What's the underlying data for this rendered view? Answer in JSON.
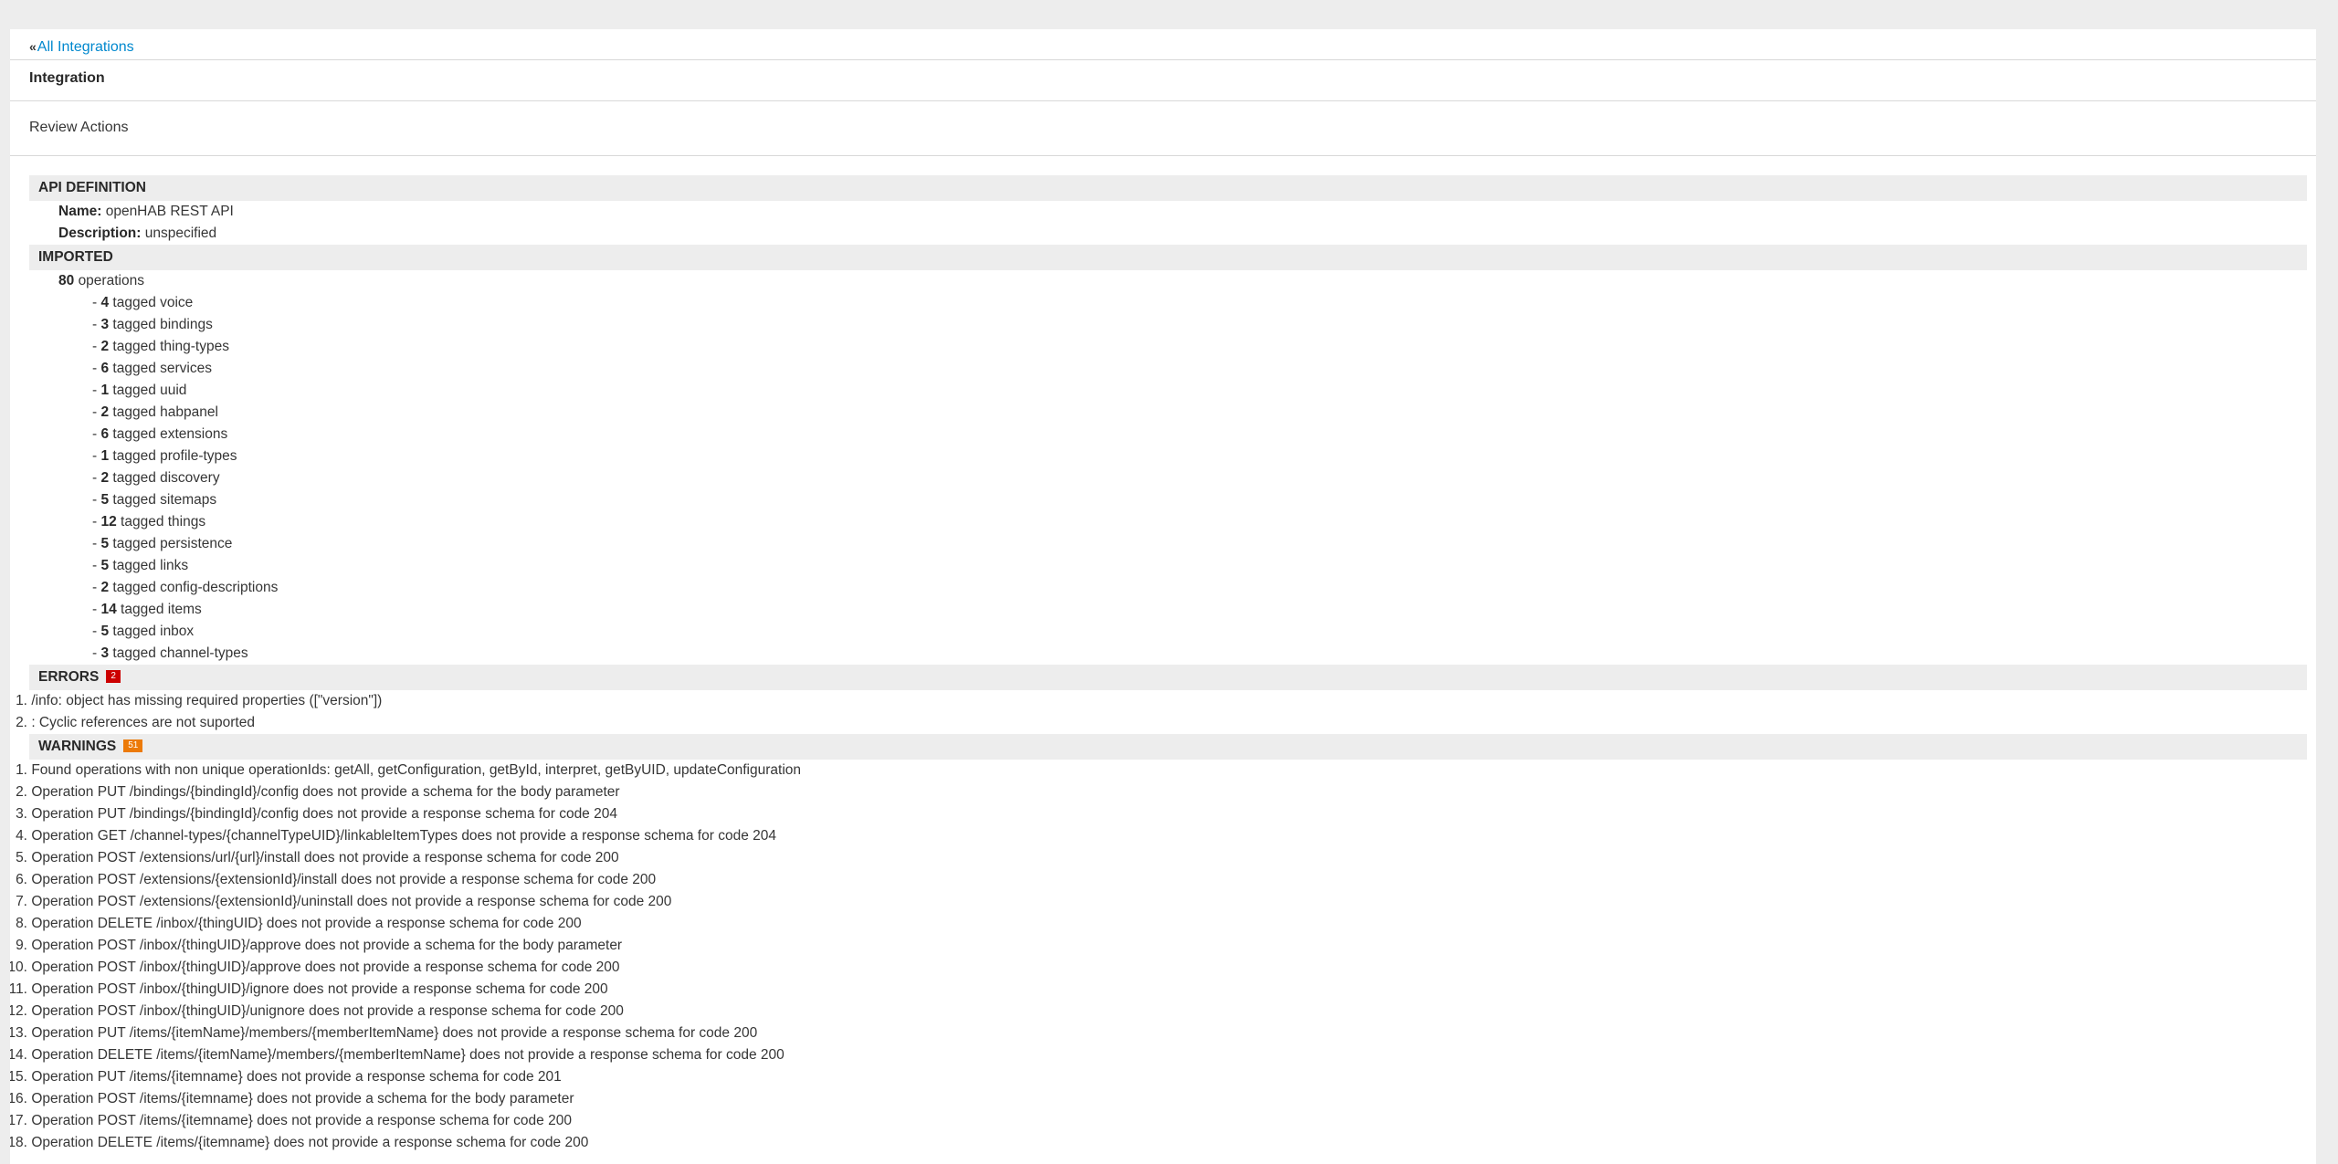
{
  "breadcrumb": {
    "link_label": "All Integrations"
  },
  "page": {
    "title": "Integration",
    "step": "Review Actions"
  },
  "api_definition": {
    "header": "API DEFINITION",
    "name_label": "Name:",
    "name_value": "openHAB REST API",
    "description_label": "Description:",
    "description_value": "unspecified"
  },
  "imported": {
    "header": "IMPORTED",
    "total": "80",
    "total_label": "operations",
    "tags": [
      {
        "count": "4",
        "label": "tagged voice"
      },
      {
        "count": "3",
        "label": "tagged bindings"
      },
      {
        "count": "2",
        "label": "tagged thing-types"
      },
      {
        "count": "6",
        "label": "tagged services"
      },
      {
        "count": "1",
        "label": "tagged uuid"
      },
      {
        "count": "2",
        "label": "tagged habpanel"
      },
      {
        "count": "6",
        "label": "tagged extensions"
      },
      {
        "count": "1",
        "label": "tagged profile-types"
      },
      {
        "count": "2",
        "label": "tagged discovery"
      },
      {
        "count": "5",
        "label": "tagged sitemaps"
      },
      {
        "count": "12",
        "label": "tagged things"
      },
      {
        "count": "5",
        "label": "tagged persistence"
      },
      {
        "count": "5",
        "label": "tagged links"
      },
      {
        "count": "2",
        "label": "tagged config-descriptions"
      },
      {
        "count": "14",
        "label": "tagged items"
      },
      {
        "count": "5",
        "label": "tagged inbox"
      },
      {
        "count": "3",
        "label": "tagged channel-types"
      }
    ]
  },
  "errors": {
    "header": "ERRORS",
    "badge": "2",
    "items": [
      {
        "num": "1.",
        "text": "/info: object has missing required properties ([\"version\"])"
      },
      {
        "num": "2.",
        "text": ": Cyclic references are not suported"
      }
    ]
  },
  "warnings": {
    "header": "WARNINGS",
    "badge": "51",
    "items": [
      {
        "num": "1.",
        "text": "Found operations with non unique operationIds: getAll, getConfiguration, getById, interpret, getByUID, updateConfiguration"
      },
      {
        "num": "2.",
        "text": "Operation PUT /bindings/{bindingId}/config does not provide a schema for the body parameter"
      },
      {
        "num": "3.",
        "text": "Operation PUT /bindings/{bindingId}/config does not provide a response schema for code 204"
      },
      {
        "num": "4.",
        "text": "Operation GET /channel-types/{channelTypeUID}/linkableItemTypes does not provide a response schema for code 204"
      },
      {
        "num": "5.",
        "text": "Operation POST /extensions/url/{url}/install does not provide a response schema for code 200"
      },
      {
        "num": "6.",
        "text": "Operation POST /extensions/{extensionId}/install does not provide a response schema for code 200"
      },
      {
        "num": "7.",
        "text": "Operation POST /extensions/{extensionId}/uninstall does not provide a response schema for code 200"
      },
      {
        "num": "8.",
        "text": "Operation DELETE /inbox/{thingUID} does not provide a response schema for code 200"
      },
      {
        "num": "9.",
        "text": "Operation POST /inbox/{thingUID}/approve does not provide a schema for the body parameter"
      },
      {
        "num": "10.",
        "text": "Operation POST /inbox/{thingUID}/approve does not provide a response schema for code 200"
      },
      {
        "num": "11.",
        "text": "Operation POST /inbox/{thingUID}/ignore does not provide a response schema for code 200"
      },
      {
        "num": "12.",
        "text": "Operation POST /inbox/{thingUID}/unignore does not provide a response schema for code 200"
      },
      {
        "num": "13.",
        "text": "Operation PUT /items/{itemName}/members/{memberItemName} does not provide a response schema for code 200"
      },
      {
        "num": "14.",
        "text": "Operation DELETE /items/{itemName}/members/{memberItemName} does not provide a response schema for code 200"
      },
      {
        "num": "15.",
        "text": "Operation PUT /items/{itemname} does not provide a response schema for code 201"
      },
      {
        "num": "16.",
        "text": "Operation POST /items/{itemname} does not provide a schema for the body parameter"
      },
      {
        "num": "17.",
        "text": "Operation POST /items/{itemname} does not provide a response schema for code 200"
      },
      {
        "num": "18.",
        "text": "Operation DELETE /items/{itemname} does not provide a response schema for code 200"
      }
    ]
  }
}
